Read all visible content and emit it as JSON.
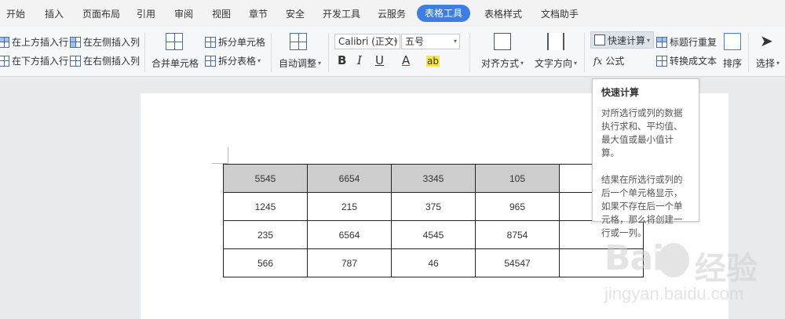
{
  "tabs": [
    "开始",
    "插入",
    "页面布局",
    "引用",
    "审阅",
    "视图",
    "章节",
    "安全",
    "开发工具",
    "云服务",
    "表格工具",
    "表格样式",
    "文档助手"
  ],
  "active_tab": "表格工具",
  "ribbon": {
    "insert_above": "在上方插入行",
    "insert_left": "在左侧插入列",
    "insert_below": "在下方插入行",
    "insert_right": "在右侧插入列",
    "merge_cells": "合并单元格",
    "split_cells": "拆分单元格",
    "split_table": "拆分表格",
    "auto_adjust": "自动调整",
    "font_name": "Calibri (正文)",
    "font_size": "五号",
    "bold": "B",
    "italic": "I",
    "underline": "U",
    "font_color": "A",
    "highlight": "ab",
    "align": "对齐方式",
    "text_direction": "文字方向",
    "quick_calc": "快速计算",
    "formula": "公式",
    "fx": "fx",
    "repeat_title": "标题行重复",
    "convert_text": "转换成文本",
    "sort": "排序",
    "select": "选择"
  },
  "tooltip": {
    "title": "快速计算",
    "para1": "对所选行或列的数据执行求和、平均值、最大值或最小值计算。",
    "para2": "结果在所选行或列的后一个单元格显示，如果不存在后一个单元格，那么将创建一行或一列。"
  },
  "table": {
    "rows": [
      [
        "5545",
        "6654",
        "3345",
        "105",
        ""
      ],
      [
        "1245",
        "215",
        "375",
        "965",
        ""
      ],
      [
        "235",
        "6564",
        "4545",
        "8754",
        ""
      ],
      [
        "566",
        "787",
        "46",
        "54547",
        ""
      ]
    ]
  },
  "watermark": {
    "brand": "Bai",
    "brand_cn": "经验",
    "url": "jingyan.baidu.com"
  }
}
